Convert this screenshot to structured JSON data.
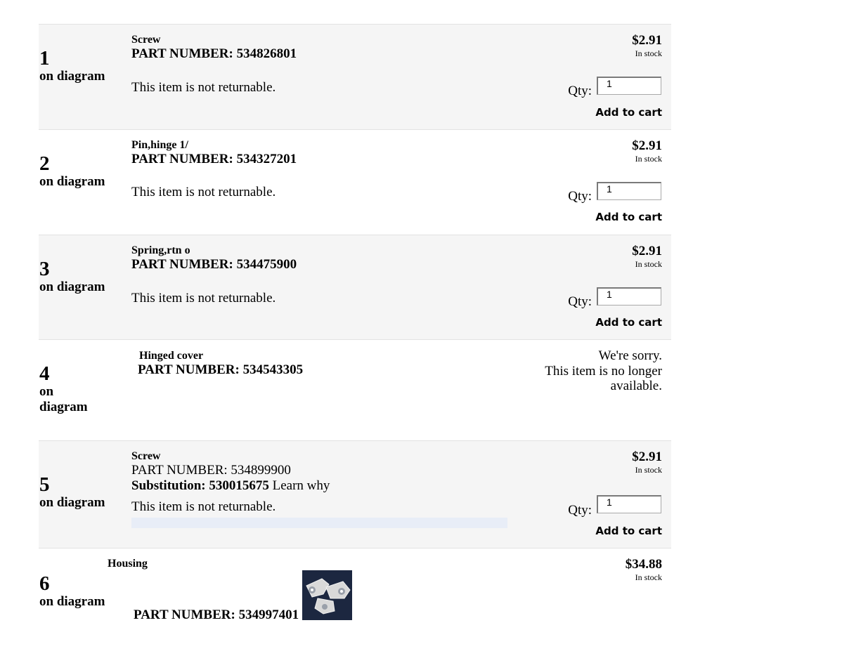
{
  "items": [
    {
      "diagram_number": "1",
      "on_diagram": "on diagram",
      "name": "Screw",
      "part_number": "PART NUMBER: 534826801",
      "returnable_note": "This item is not returnable.",
      "price": "$2.91",
      "stock": "In stock",
      "qty_label": "Qty:",
      "qty_value": "1",
      "add_to_cart": "Add to cart"
    },
    {
      "diagram_number": "2",
      "on_diagram": "on diagram",
      "name": "Pin,hinge 1/",
      "part_number": "PART NUMBER: 534327201",
      "returnable_note": "This item is not returnable.",
      "price": "$2.91",
      "stock": "In stock",
      "qty_label": "Qty:",
      "qty_value": "1",
      "add_to_cart": "Add to cart"
    },
    {
      "diagram_number": "3",
      "on_diagram": "on diagram",
      "name": "Spring,rtn o",
      "part_number": "PART NUMBER: 534475900",
      "returnable_note": "This item is not returnable.",
      "price": "$2.91",
      "stock": "In stock",
      "qty_label": "Qty:",
      "qty_value": "1",
      "add_to_cart": "Add to cart"
    },
    {
      "diagram_number": "4",
      "on_word": "on",
      "diagram_word": "diagram",
      "name": "Hinged cover",
      "part_number": "PART NUMBER: 534543305",
      "unavailable_line1": "We're sorry.",
      "unavailable_line2": "This item is no longer",
      "unavailable_line3": "available."
    },
    {
      "diagram_number": "5",
      "on_diagram": "on diagram",
      "name": "Screw",
      "part_number": "PART NUMBER: 534899900",
      "substitution_label": "Substitution: 530015675",
      "learn_why": "Learn why",
      "returnable_note": "This item is not returnable.",
      "price": "$2.91",
      "stock": "In stock",
      "qty_label": "Qty:",
      "qty_value": "1",
      "add_to_cart": "Add to cart"
    },
    {
      "diagram_number": "6",
      "on_diagram": "on diagram",
      "name": "Housing",
      "part_number": "PART NUMBER: 534997401",
      "price": "$34.88",
      "stock": "In stock",
      "thumbnail_icon": "housing-part-thumbnail"
    }
  ],
  "colors": {
    "shaded_row": "#f5f5f5",
    "thumbnail_bg": "#1c2740",
    "substitution_bar": "#e8edf7"
  }
}
